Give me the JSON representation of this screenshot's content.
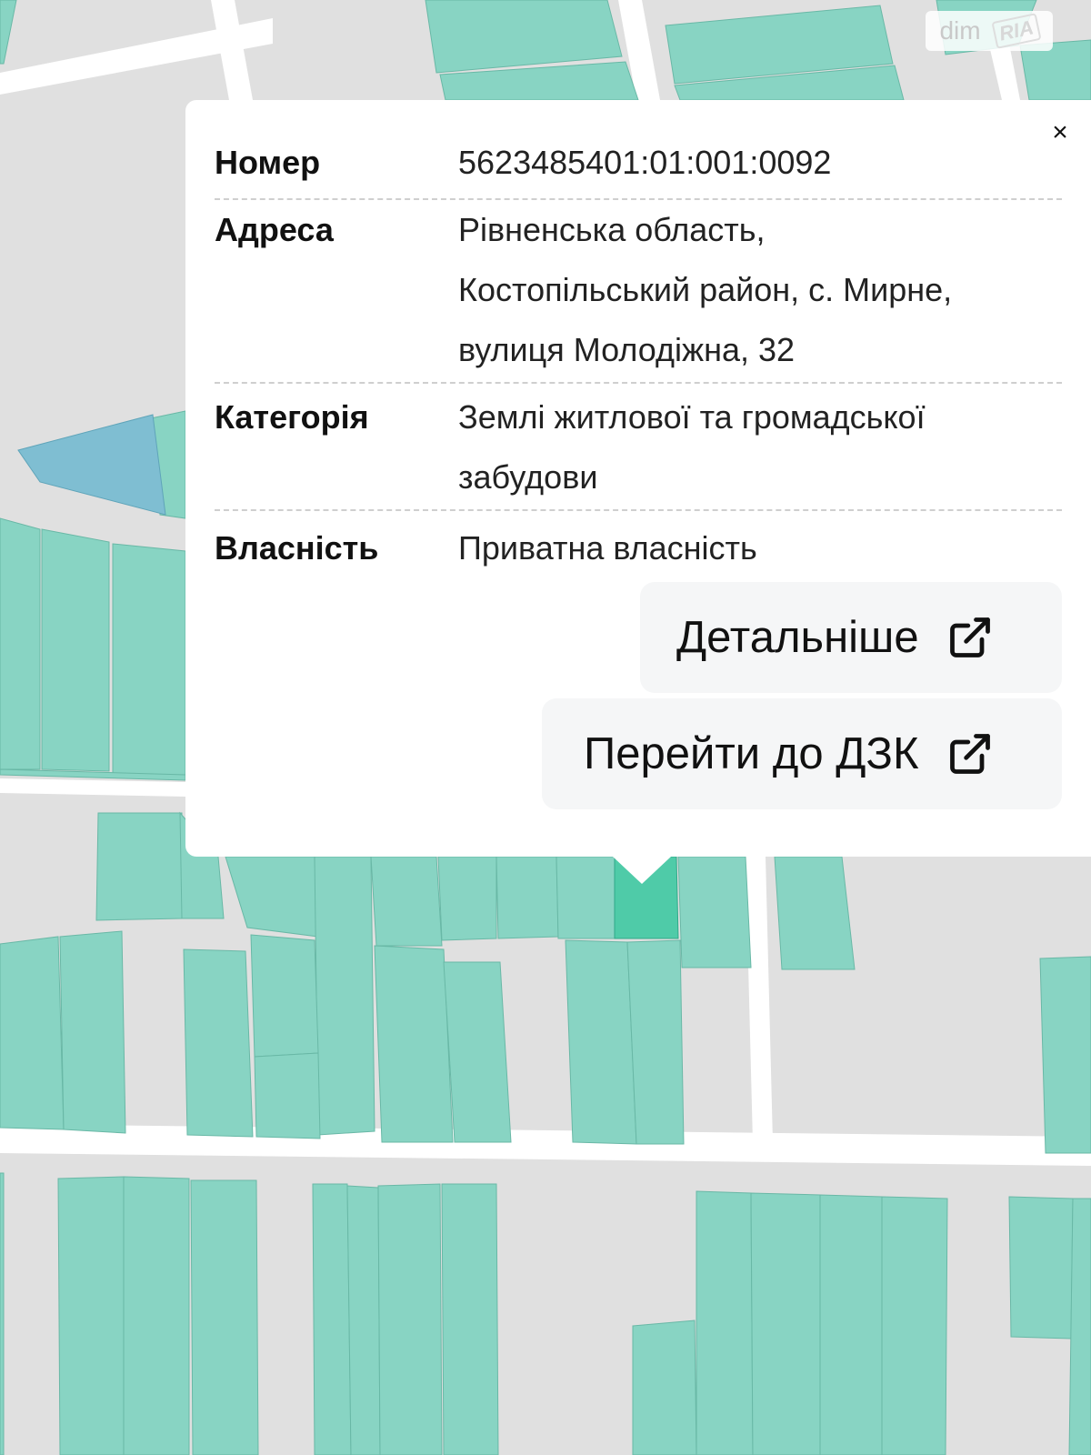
{
  "colors": {
    "background": "#e0e0e0",
    "parcel": "#88d4c3",
    "parcel_selected": "#4fcba8",
    "parcel_water": "#7fbed2",
    "road": "#ffffff",
    "popup": "#ffffff",
    "button_bg": "#f5f6f7"
  },
  "watermark": {
    "dim": "dim",
    "ria": "RIA"
  },
  "popup": {
    "close_label": "×",
    "rows": [
      {
        "label": "Номер",
        "lines": [
          "5623485401:01:001:0092"
        ]
      },
      {
        "label": "Адреса",
        "lines": [
          "Рівненська область,",
          "Костопільський район, с. Мирне,",
          "вулиця Молодіжна, 32"
        ]
      },
      {
        "label": "Категорія",
        "lines": [
          "Землі житлової та громадської",
          "забудови"
        ]
      },
      {
        "label": "Власність",
        "lines": [
          "Приватна власність"
        ]
      }
    ],
    "buttons": {
      "details": {
        "label": "Детальніше",
        "icon": "external-link-icon"
      },
      "dzk": {
        "label": "Перейти до ДЗК",
        "icon": "external-link-icon"
      }
    }
  }
}
